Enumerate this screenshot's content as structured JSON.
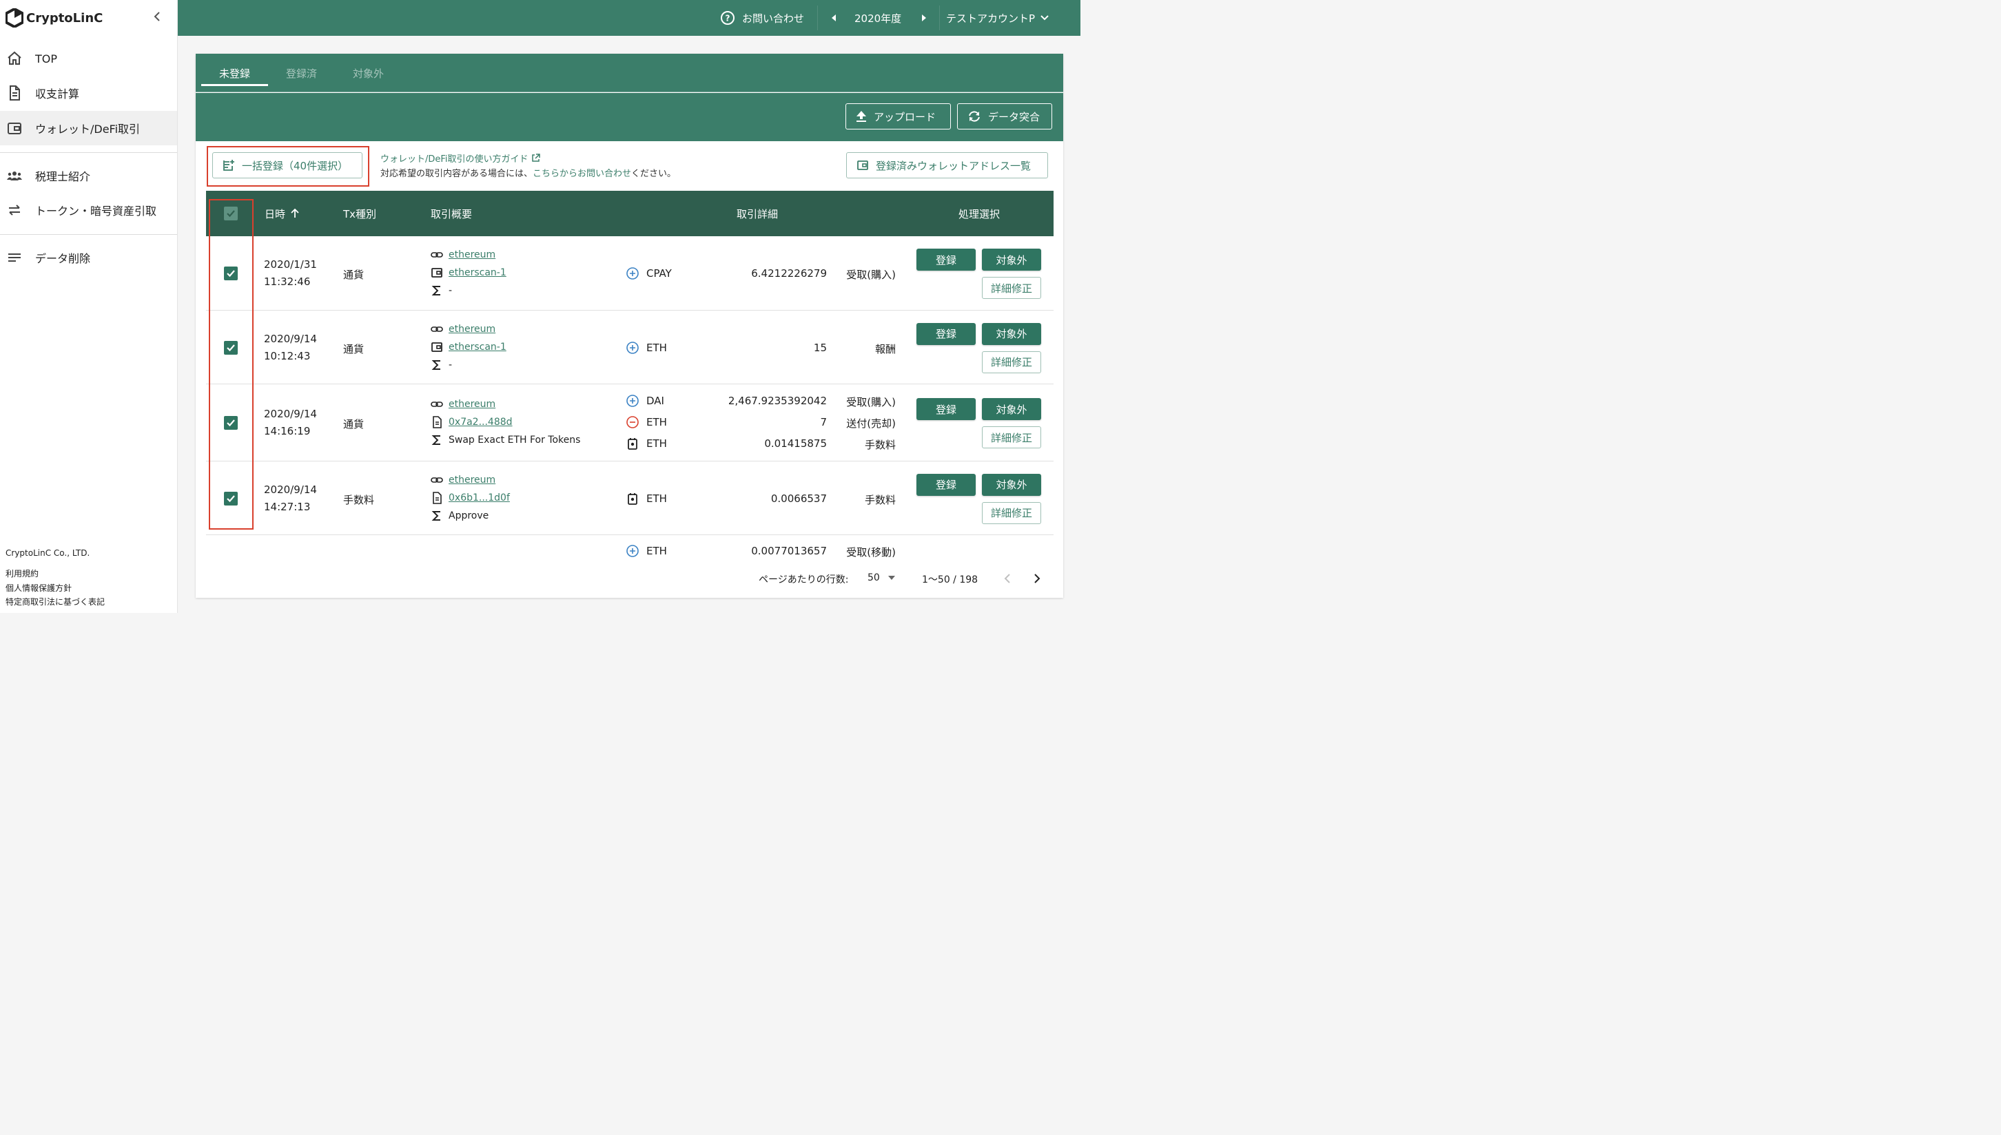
{
  "app": {
    "logo": "CryptoLinC"
  },
  "sidebar": {
    "items": [
      {
        "label": "TOP"
      },
      {
        "label": "収支計算"
      },
      {
        "label": "ウォレット/DeFi取引"
      },
      {
        "label": "税理士紹介"
      },
      {
        "label": "トークン・暗号資産引取"
      },
      {
        "label": "データ削除"
      }
    ],
    "footer": {
      "company": "CryptoLinC Co., LTD.",
      "terms": "利用規約",
      "privacy": "個人情報保護方針",
      "commerce": "特定商取引法に基づく表記"
    }
  },
  "topbar": {
    "contact": "お問い合わせ",
    "year": "2020年度",
    "account": "テストアカウントP"
  },
  "tabs": [
    {
      "label": "未登録"
    },
    {
      "label": "登録済"
    },
    {
      "label": "対象外"
    }
  ],
  "actions": {
    "upload": "アップロード",
    "reconcile": "データ突合"
  },
  "bulk": {
    "label": "一括登録（40件選択）"
  },
  "guide": {
    "link": "ウォレット/DeFi取引の使い方ガイド",
    "text_before": "対応希望の取引内容がある場合には、",
    "text_link": "こちらからお問い合わせ",
    "text_after": "ください。"
  },
  "registered_wallets": "登録済みウォレットアドレス一覧",
  "table": {
    "headers": {
      "datetime": "日時",
      "tx_type": "Tx種別",
      "summary": "取引概要",
      "detail": "取引詳細",
      "action": "処理選択"
    },
    "rows": [
      {
        "date": "2020/1/31",
        "time": "11:32:46",
        "tx_type": "通貨",
        "chain": "ethereum",
        "source": "etherscan-1",
        "method": "-",
        "lines": [
          {
            "sign": "plus",
            "token": "CPAY",
            "amount": "6.4212226279",
            "kind": "受取(購入)"
          }
        ]
      },
      {
        "date": "2020/9/14",
        "time": "10:12:43",
        "tx_type": "通貨",
        "chain": "ethereum",
        "source": "etherscan-1",
        "method": "-",
        "lines": [
          {
            "sign": "plus",
            "token": "ETH",
            "amount": "15",
            "kind": "報酬"
          }
        ]
      },
      {
        "date": "2020/9/14",
        "time": "14:16:19",
        "tx_type": "通貨",
        "chain": "ethereum",
        "source": "0x7a2...488d",
        "method": "Swap Exact ETH For Tokens",
        "lines": [
          {
            "sign": "plus",
            "token": "DAI",
            "amount": "2,467.9235392042",
            "kind": "受取(購入)"
          },
          {
            "sign": "minus",
            "token": "ETH",
            "amount": "7",
            "kind": "送付(売却)"
          },
          {
            "sign": "fee",
            "token": "ETH",
            "amount": "0.01415875",
            "kind": "手数料"
          }
        ]
      },
      {
        "date": "2020/9/14",
        "time": "14:27:13",
        "tx_type": "手数料",
        "chain": "ethereum",
        "source": "0x6b1...1d0f",
        "method": "Approve",
        "lines": [
          {
            "sign": "fee",
            "token": "ETH",
            "amount": "0.0066537",
            "kind": "手数料"
          }
        ]
      }
    ],
    "partial": {
      "token": "ETH",
      "amount": "0.0077013657",
      "kind": "受取(移動)"
    },
    "buttons": {
      "register": "登録",
      "exclude": "対象外",
      "edit": "詳細修正"
    }
  },
  "pagination": {
    "rows_label": "ページあたりの行数:",
    "rows_value": "50",
    "range": "1〜50 / 198"
  },
  "colors": {
    "primary": "#3b7e6a",
    "header": "#2f5e4e",
    "highlight": "#d9402d"
  }
}
